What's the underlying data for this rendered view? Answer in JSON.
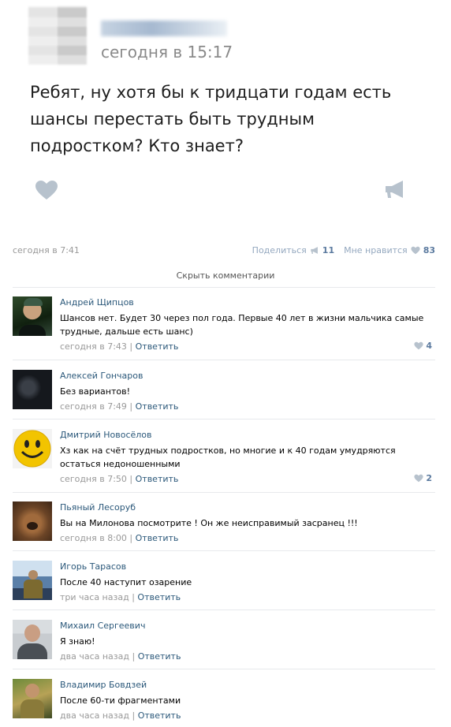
{
  "post": {
    "time": "сегодня в 15:17",
    "text": "Ребят, ну хотя бы к тридцати годам есть шансы перестать быть трудным подростком? Кто знает?",
    "date": "сегодня в 7:41",
    "share_label": "Поделиться",
    "share_count": "11",
    "like_label": "Мне нравится",
    "like_count": "83",
    "hide_comments": "Скрыть комментарии"
  },
  "comments": [
    {
      "name": "Андрей Щипцов",
      "text": "Шансов нет. Будет 30 через пол года. Первые 40 лет в жизни мальчика самые трудные, дальше есть шанс)",
      "time": "сегодня в 7:43",
      "reply": "Ответить",
      "likes": "4"
    },
    {
      "name": "Алексей Гончаров",
      "text": "Без вариантов!",
      "time": "сегодня в 7:49",
      "reply": "Ответить"
    },
    {
      "name": "Дмитрий Новосёлов",
      "text": "Хз как на счёт трудных подростков, но многие и к 40 годам умудряются остаться недоношенными",
      "time": "сегодня в 7:50",
      "reply": "Ответить",
      "likes": "2"
    },
    {
      "name": "Пьяный Лесоруб",
      "text": "Вы на Милонова посмотрите ! Он же неисправимый засранец !!!",
      "time": "сегодня в 8:00",
      "reply": "Ответить"
    },
    {
      "name": "Игорь Тарасов",
      "text": "После 40 наступит озарение",
      "time": "три часа назад",
      "reply": "Ответить"
    },
    {
      "name": "Михаил Сергеевич",
      "text": "Я знаю!",
      "time": "два часа назад",
      "reply": "Ответить"
    },
    {
      "name": "Владимир Бовдзей",
      "text": "После 60-ти фрагментами",
      "time": "два часа назад",
      "reply": "Ответить"
    }
  ],
  "icons": {
    "like": "heart-icon",
    "share": "megaphone-icon"
  },
  "colors": {
    "link": "#2b587a",
    "muted": "#999999",
    "icon": "#b0bcc8"
  }
}
